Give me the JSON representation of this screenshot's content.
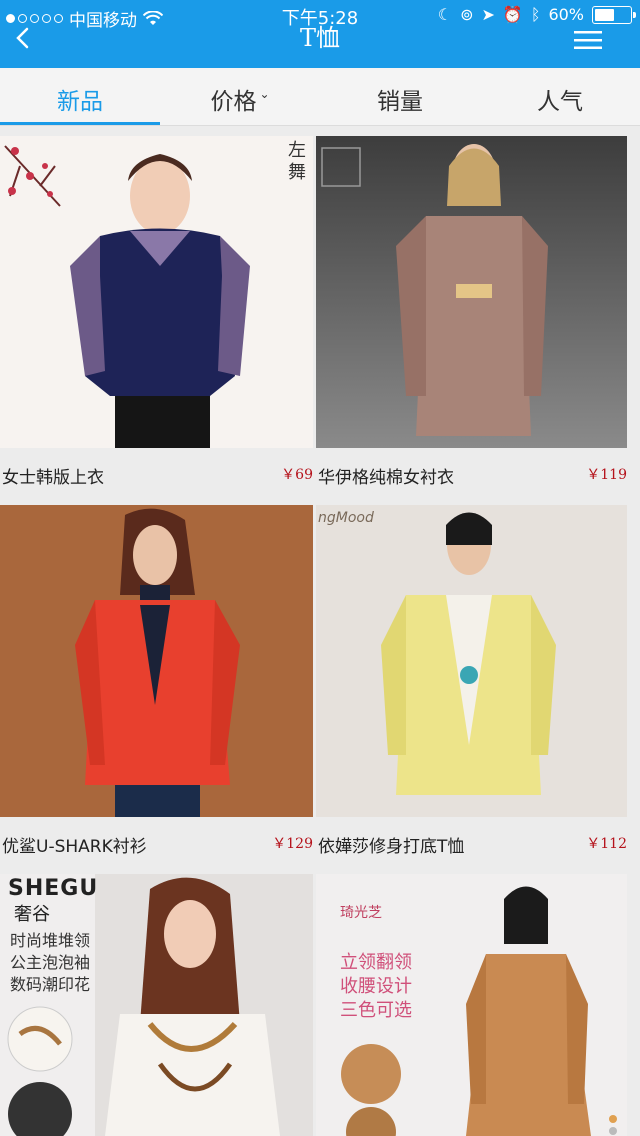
{
  "status_bar": {
    "carrier": "中国移动",
    "time": "下午5:28",
    "battery": "60%",
    "battery_level": 0.6
  },
  "nav": {
    "title": "T恤",
    "back_icon": "back-chevron-icon",
    "menu_icon": "menu-icon"
  },
  "tabs": [
    {
      "label": "新品",
      "active": true
    },
    {
      "label": "价格",
      "has_dropdown": true
    },
    {
      "label": "销量"
    },
    {
      "label": "人气"
    }
  ],
  "products": [
    {
      "name": "女士韩版上衣",
      "price": "￥69"
    },
    {
      "name": "华伊格纯棉女衬衣",
      "price": "￥119"
    },
    {
      "name": "优鲨U-SHARK衬衫",
      "price": "￥129"
    },
    {
      "name": "依嬅莎修身打底T恤",
      "price": "￥112"
    },
    {
      "name": "",
      "price": ""
    },
    {
      "name": "",
      "price": ""
    }
  ],
  "image_texts": {
    "p1_brand": "左舞",
    "p3_brand": "",
    "p4_brand": "ngMood",
    "p5_brand": "SHEGU",
    "p5_brand_cn": "奢谷",
    "p5_lines": [
      "时尚堆堆领",
      "公主泡泡袖",
      "数码潮印花"
    ],
    "p6_brand": "琦光芝",
    "p6_lines": [
      "立领翻领",
      "收腰设计",
      "三色可选"
    ]
  },
  "colors": {
    "accent": "#1a9be8",
    "price": "#b5121b"
  }
}
